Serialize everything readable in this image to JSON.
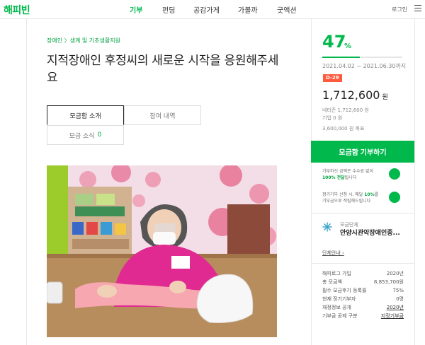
{
  "nav": {
    "logo": "해피빈",
    "items": [
      {
        "label": "기부",
        "active": true
      },
      {
        "label": "펀딩",
        "active": false
      },
      {
        "label": "공감가게",
        "active": false
      },
      {
        "label": "가볼까",
        "active": false
      },
      {
        "label": "굿액션",
        "active": false
      }
    ],
    "login": "로그인"
  },
  "campaign": {
    "category": "장애인 〉생계 및 기초생활지원",
    "title": "지적장애인 후정씨의 새로운 시작을 응원해주세요",
    "tabs": {
      "intro": "모금함 소개",
      "history": "참여 내역",
      "news": "모금 소식",
      "news_count": "0"
    }
  },
  "funding": {
    "percent": "47",
    "percent_sign": "%",
    "progress_fraction": 0.47,
    "period": "2021.04.02 ~ 2021.06.30까지",
    "dday": "D-29",
    "amount": "1,712,600",
    "won": "원",
    "netizen": "네티즌 1,712,600 원",
    "company": "기업 0 원",
    "goal": "3,600,000 원 목표",
    "donate_button": "모금함 기부하기"
  },
  "info": {
    "fee_line1": "기부하신 금액은 수수료 없이",
    "fee_line2_bold": "100% 전달",
    "fee_line2_rest": "됩니다",
    "regular_line1_a": "정기기부 신청 시, 매달 ",
    "regular_line1_bold": "10%",
    "regular_line1_b": "를",
    "regular_line2": "기부금으로 적립해드립니다"
  },
  "org": {
    "label": "모금단체",
    "name": "안양시관악장애인종...",
    "link": "단체안내 ›"
  },
  "stats": [
    {
      "label": "해피로그 가입",
      "value": "2020년",
      "link": false
    },
    {
      "label": "총 모금액",
      "value": "8,853,700원",
      "link": false
    },
    {
      "label": "필수 모금후기 등록률",
      "value": "75%",
      "link": false
    },
    {
      "label": "현재 정기기부자",
      "value": "0명",
      "link": false
    },
    {
      "label": "재정정보 공개",
      "value": "2020년",
      "link": true
    },
    {
      "label": "기부금 공제 구분",
      "value": "지정기부금",
      "link": true
    }
  ],
  "colors": {
    "accent": "#00b84b",
    "dday": "#ff5a3d"
  }
}
